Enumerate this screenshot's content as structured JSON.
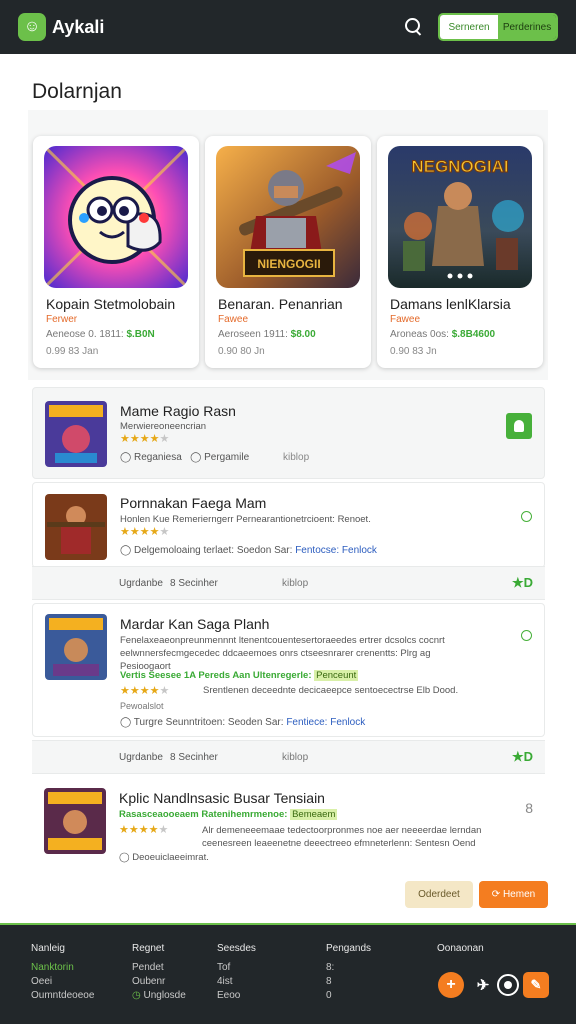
{
  "header": {
    "brand": "Aykali",
    "tab_primary": "Serneren",
    "tab_secondary": "Perderines"
  },
  "page_title": "Dolarnjan",
  "featured": [
    {
      "title": "Kopain Stetmolobain",
      "sub": "Ferwer",
      "price_prefix": "Aeneose 0. 1811:",
      "price": "$.B0N",
      "meta": "0.99 83 Jan"
    },
    {
      "title": "Benaran. Penanrian",
      "sub": "Fawee",
      "price_prefix": "Aeroseen 1911:",
      "price": "$8.00",
      "meta": "0.90 80 Jn"
    },
    {
      "title": "Damans lenlKlarsia",
      "sub": "Fawee",
      "price_prefix": "Aroneas 0os:",
      "price": "$.8B4600",
      "meta": "0.90 83 Jn"
    }
  ],
  "featured_banner": "NEGNOGIAI",
  "featured_banner2": "NIENGOGII",
  "items": [
    {
      "name": "Mame Ragio Rasn",
      "desc": "Merwiereoneencrian",
      "row_a": "Reganiesa",
      "row_b": "Pergamile",
      "row_c": "kiblop"
    },
    {
      "name": "Pornnakan Faega Mam",
      "desc": "Honlen Kue Remerierngerr Pernearantionetrcioent: Renoet.",
      "row_left": "Delgemoloaing terlaet: Soedon Sar:",
      "row_link": "Fentocse: Fenlock",
      "sub_a": "Ugrdanbe",
      "sub_b": "8  Secinher",
      "sub_c": "kiblop"
    },
    {
      "name": "Mardar Kan Saga Planh",
      "desc": "Fenelaxeaeonpreunmennnt ltenentcouentesertoraeedes ertrer dcsolcs cocnrt eelwnnersfecmgecedec ddcaeemoes onrs ctseesnrarer crenentts: Plrg ag Pesioogaort",
      "green_line": "Vertis Seesee 1A Pereds Aan Ultenregerle:",
      "green_tag": "Penceunt",
      "detail": "Srentlenen deceednte decicaeepce sentoecectrse Elb Dood.",
      "extra": "Pewoalslot",
      "row_left": "Turgre Seunntritoen: Seoden Sar:",
      "row_link": "Fentiece: Fenlock",
      "sub_a": "Ugrdanbe",
      "sub_b": "8  Secinher",
      "sub_c": "kiblop"
    },
    {
      "name": "Kplic Nandlnsasic Busar Tensiain",
      "green_line": "Rasasceaooeaem Ratenihemrmenoe:",
      "green_tag": "Bemeaem",
      "detail": "Alr demeneeemaae tedectoorpronmes noe aer neeeerdae lerndan ceenesreen leaeenetne deeectreeo efmneterlenn: Sentesn Oend Iteerhan",
      "extra": "Deoeuiclaeeimrat."
    }
  ],
  "actions": {
    "cancel": "Oderdeet",
    "confirm": "Hemen"
  },
  "footer": {
    "cols": [
      {
        "head": "Nanleig",
        "items": [
          "Nanktorin",
          "Oeei",
          "Oumntdeoeoe"
        ]
      },
      {
        "head": "Regnet",
        "items": [
          "Pendet",
          "Oubenr",
          "Unglosde"
        ]
      },
      {
        "head": "Seesdes",
        "items": [
          "Tof",
          "4ist",
          "Eeoo"
        ]
      },
      {
        "head": "Pengands",
        "items": [
          "8:",
          "8",
          "0"
        ]
      },
      {
        "head": "Oonaonan",
        "items": []
      }
    ]
  },
  "colors": {
    "accent": "#6cc04a",
    "orange": "#f47d20",
    "header_bg": "#22272a"
  }
}
